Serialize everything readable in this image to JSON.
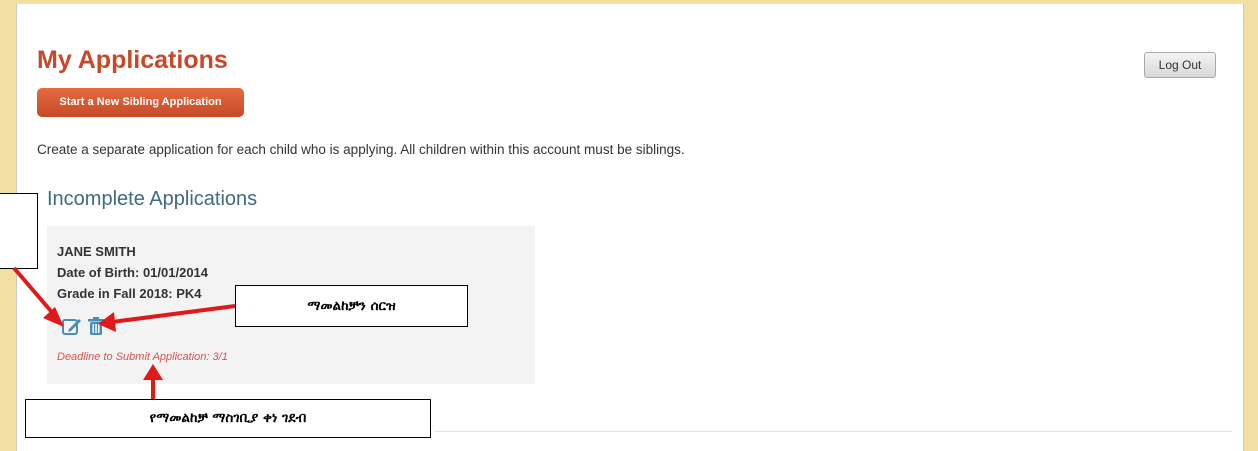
{
  "header": {
    "title": "My Applications",
    "new_application_label": "Start a New Sibling Application",
    "logout_label": "Log Out"
  },
  "description": "Create a separate application for each child who is applying. All children within this account must be siblings.",
  "section_title": "Incomplete Applications",
  "application": {
    "name": "JANE SMITH",
    "dob": "Date of Birth: 01/01/2014",
    "grade": "Grade in Fall 2018: PK4",
    "deadline": "Deadline to Submit Application: 3/1",
    "icons": [
      "edit-icon",
      "trash-icon"
    ]
  },
  "callouts": {
    "delete": "ማመልከቻን ሰርዝ",
    "deadline": "የማመልከቻ ማስገቢያ ቀነ ገደብ",
    "edit": ""
  },
  "colors": {
    "accent": "#c8482b",
    "heading_blue": "#3e6b80",
    "deadline_red": "#d9534f",
    "frame": "#f2dfa3",
    "arrow": "#e0191b"
  }
}
